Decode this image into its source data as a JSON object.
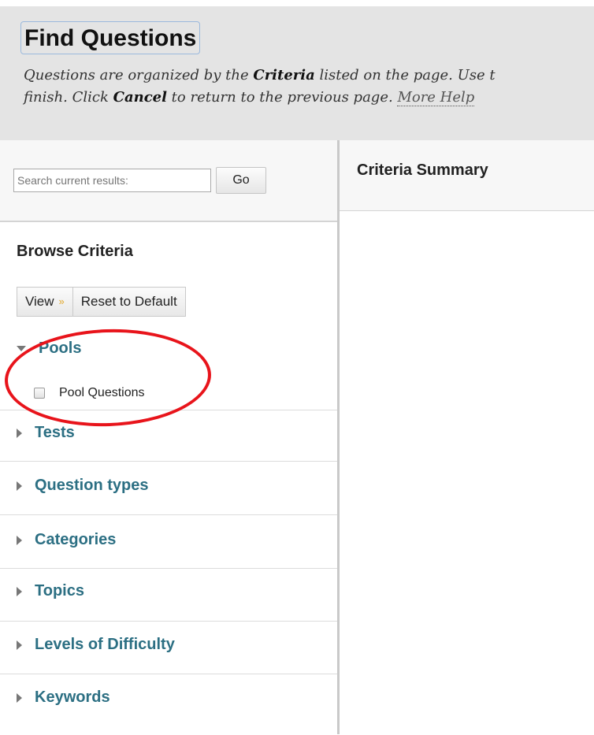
{
  "header": {
    "title": "Find Questions",
    "instructions_parts": {
      "p1": "Questions are organized by the ",
      "criteria": "Criteria",
      "p2": " listed on the page. Use t",
      "p3": "finish. Click ",
      "cancel": "Cancel",
      "p4": " to return to the previous page. ",
      "more_help": "More Help"
    }
  },
  "search": {
    "placeholder": "Search current results:",
    "go_label": "Go"
  },
  "browse": {
    "title": "Browse Criteria",
    "view_label": "View",
    "view_chevron": "»",
    "reset_label": "Reset to Default",
    "sections": [
      {
        "label": "Pools",
        "expanded": true
      },
      {
        "label": "Tests",
        "expanded": false
      },
      {
        "label": "Question types",
        "expanded": false
      },
      {
        "label": "Categories",
        "expanded": false
      },
      {
        "label": "Topics",
        "expanded": false
      },
      {
        "label": "Levels of Difficulty",
        "expanded": false
      },
      {
        "label": "Keywords",
        "expanded": false
      }
    ],
    "pools_option": "Pool Questions"
  },
  "summary": {
    "title": "Criteria Summary"
  },
  "colors": {
    "link_teal": "#2c6f83",
    "annotation_red": "#e8141b",
    "header_bg": "#e4e4e4"
  }
}
